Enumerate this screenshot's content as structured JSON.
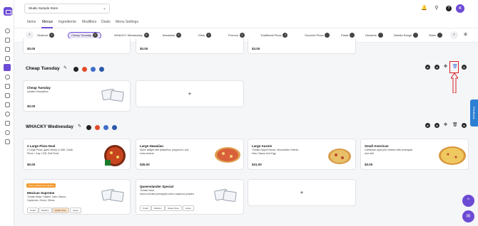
{
  "sidebar": {
    "icons": [
      "home-icon",
      "store-icon",
      "list-icon",
      "grid-icon",
      "menu-icon",
      "gear-icon",
      "bag-icon",
      "calendar-icon",
      "doc-icon",
      "users-icon",
      "chart-icon",
      "link-icon",
      "tag-icon",
      "print-icon",
      "box-icon",
      "receipt-icon"
    ]
  },
  "header": {
    "store_name": "Studio Sample Store",
    "avatar_initial": "K",
    "help_label": "?"
  },
  "tabs": [
    "Items",
    "Menus",
    "Ingredients",
    "Modifiers",
    "Deals",
    "Menu Settings"
  ],
  "active_tab": "Menus",
  "chips": [
    {
      "label": "Seafood",
      "count": "4"
    },
    {
      "label": "Cheap Tuesday",
      "count": "4"
    },
    {
      "label": "WHACKY Wednesday",
      "count": "6"
    },
    {
      "label": "Breakfast",
      "count": "4"
    },
    {
      "label": "Diets",
      "count": "1"
    },
    {
      "label": "Promos",
      "count": "4"
    },
    {
      "label": "Traditional Pizza",
      "count": "4"
    },
    {
      "label": "Gourmet Pizza",
      "count": ""
    },
    {
      "label": "Pasta",
      "count": ""
    },
    {
      "label": "Desserts",
      "count": ""
    },
    {
      "label": "Nutella Range",
      "count": ""
    },
    {
      "label": "Sides",
      "count": ""
    }
  ],
  "top_row_prices": [
    "$0.00",
    "$0.00",
    "$3.00"
  ],
  "sections": [
    {
      "title": "Cheap Tuesday",
      "items": [
        {
          "title": "Cheap Tuesday",
          "desc": "Update Description",
          "price": "$0.00"
        }
      ]
    },
    {
      "title": "WHACKY Wednesday",
      "items": [
        {
          "title": "2 Large Pizza Deal",
          "desc": "2 Large Pizza, garlic Bread or SML Garlic Pizza + Any 1.25L Soft Drink",
          "price": "$0.00"
        },
        {
          "title": "Large Hawaiian",
          "desc": "Spice delight with jalapeños, pepperoni, and extra cheese",
          "price": "$35.00"
        },
        {
          "title": "Large Aussie",
          "desc": "Tomato Napoli Sauce, Mozzarella Cheese, Ham, Bacon And Egg",
          "price": "$31.00"
        },
        {
          "title": "Small American",
          "desc": "Caribbean-style jerk chicken with pineapple and chili",
          "price": "$0.00"
        },
        {
          "title": "Mexican Supreme",
          "desc": "Tomato Base, Salami, Ham, Bacon, Capsicum, Onion, Olives",
          "price": "",
          "badge": "Some variants are inactive",
          "tags": [
            "Small",
            "Medium",
            "Gluten Free",
            "Large"
          ]
        },
        {
          "title": "Queenslander Special",
          "desc": "Tomato base, bacon,chicken,pineapple,onion,capsicum,prawns",
          "price": "",
          "tags": [
            "Small",
            "Medium",
            "Gluten Free",
            "Large"
          ]
        }
      ]
    }
  ],
  "feedback_label": "Feedback",
  "colors": {
    "accent": "#6c4bd4",
    "annotation": "#d82020",
    "feedback": "#2d7fd3"
  }
}
